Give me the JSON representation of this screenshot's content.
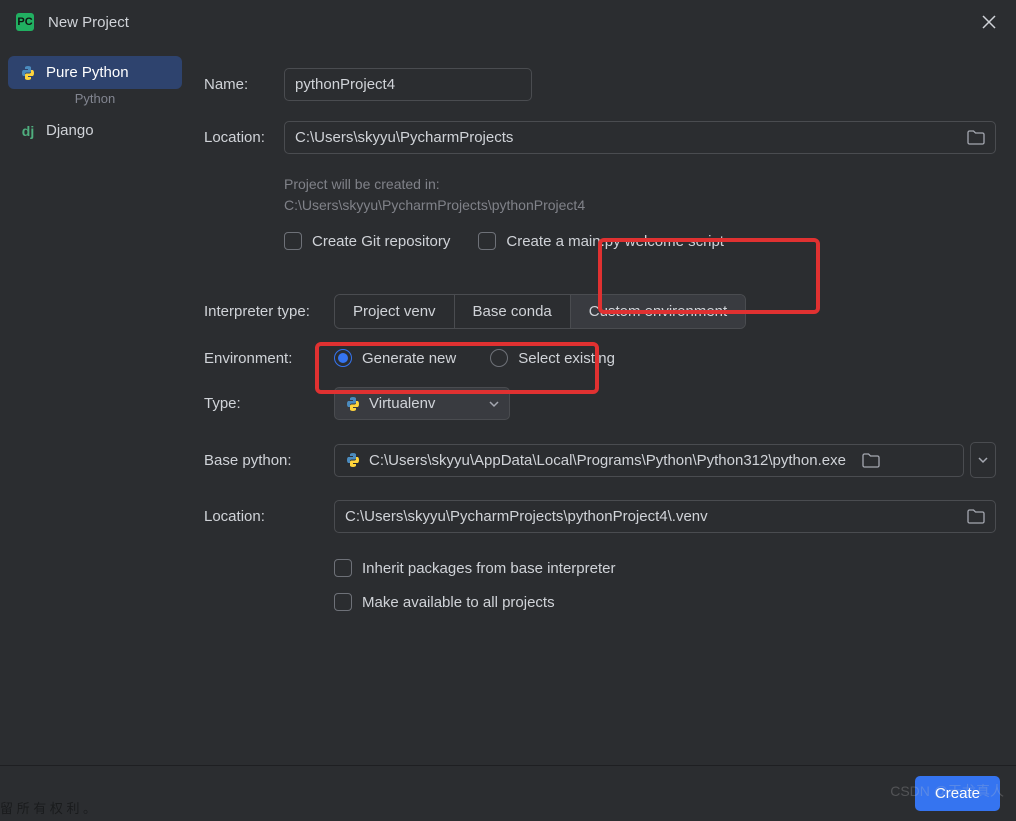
{
  "titlebar": {
    "title": "New Project"
  },
  "sidebar": {
    "items": [
      {
        "label": "Pure Python"
      },
      {
        "label": "Django"
      }
    ],
    "sub_label": "Python"
  },
  "form": {
    "name_label": "Name:",
    "name_value": "pythonProject4",
    "loc_label": "Location:",
    "loc_value": "C:\\Users\\skyyu\\PycharmProjects",
    "hint_line1": "Project will be created in:",
    "hint_line2": "C:\\Users\\skyyu\\PycharmProjects\\pythonProject4",
    "check_git": "Create Git repository",
    "check_main": "Create a main.py welcome script",
    "interp_label": "Interpreter type:",
    "interp_opts": {
      "venv": "Project venv",
      "conda": "Base conda",
      "custom": "Custom environment"
    },
    "env_label": "Environment:",
    "env_gen": "Generate new",
    "env_sel": "Select existing",
    "type_label": "Type:",
    "type_value": "Virtualenv",
    "base_label": "Base python:",
    "base_value": "C:\\Users\\skyyu\\AppData\\Local\\Programs\\Python\\Python312\\python.exe",
    "loc2_label": "Location:",
    "loc2_value": "C:\\Users\\skyyu\\PycharmProjects\\pythonProject4\\.venv",
    "check_inherit": "Inherit packages from base interpreter",
    "check_allproj": "Make available to all projects"
  },
  "footer": {
    "create": "Create"
  },
  "watermark": "CSDN @天龙真人",
  "decorative_text": "留 所 有 权 利 。"
}
